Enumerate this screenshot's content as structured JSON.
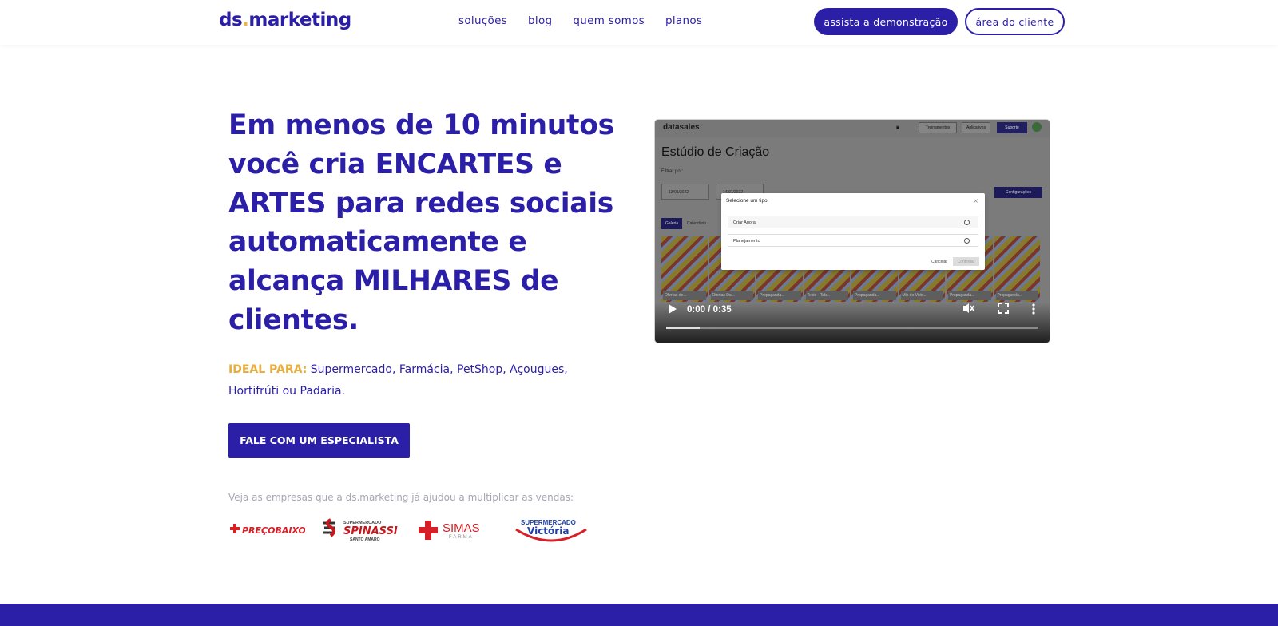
{
  "header": {
    "logo_main": "ds",
    "logo_dot": ".",
    "logo_rest": "marketing",
    "nav": [
      "soluções",
      "blog",
      "quem somos",
      "planos"
    ],
    "demo_button": "assista a demonstração",
    "client_button": "área do cliente"
  },
  "hero": {
    "headline": "Em menos de 10 minutos você cria ENCARTES e ARTES para redes sociais automaticamente e alcança MILHARES de clientes.",
    "ideal_label": "IDEAL PARA:",
    "ideal_text": " Supermercado, Farmácia, PetShop, Açougues, Hortifrúti ou Padaria.",
    "cta": "FALE COM UM ESPECIALISTA",
    "companies_text": "Veja as empresas que a ds.marketing já ajudou a multiplicar as vendas:"
  },
  "logos": [
    {
      "name": "PREÇOBAIXO",
      "color": "#d61f26"
    },
    {
      "name": "SPINASSI",
      "line1": "SUPERMERCADO",
      "line3": "SANTO AMARO",
      "color": "#c8161d"
    },
    {
      "name": "SIMAS",
      "line2": "FARMA",
      "color": "#d61f26"
    },
    {
      "name": "Victória",
      "line1": "SUPERMERCADO",
      "color": "#1f3fa8"
    }
  ],
  "video": {
    "app_brand": "datasales",
    "app_title": "Estúdio de Criação",
    "filter_label": "Filtrar por:",
    "date_from": "13/01/2022",
    "date_to": "14/01/2022",
    "toolbar": [
      "Treinamentos",
      "Aplicativos",
      "Suporte"
    ],
    "config": "Configurações",
    "tabs": [
      "Galeria",
      "Calendário"
    ],
    "thumb_labels": [
      "Ofertas de...",
      "Ofertas Da...",
      "Propaganda...",
      "Teste - Tab...",
      "Propaganda...",
      "Mix do Vitór...",
      "Propaganda...",
      "Propaganda..."
    ],
    "modal_title": "Selecione um tipo",
    "modal_options": [
      "Criar Agora",
      "Planejamento"
    ],
    "modal_cancel": "Cancelar",
    "modal_continue": "Continuar",
    "time": "0:00 / 0:35",
    "progress": 0.09
  }
}
